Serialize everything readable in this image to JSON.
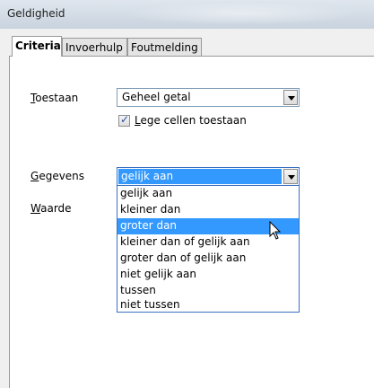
{
  "window": {
    "title": "Geldigheid"
  },
  "tabs": [
    {
      "label": "Criteria",
      "active": true
    },
    {
      "label": "Invoerhulp",
      "active": false
    },
    {
      "label": "Foutmelding",
      "active": false
    }
  ],
  "form": {
    "toestaan_label_u": "T",
    "toestaan_label_rest": "oestaan",
    "toestaan_value": "Geheel getal",
    "blank_label_u": "L",
    "blank_label_rest": "ege cellen toestaan",
    "blank_checked": true,
    "gegevens_label_u": "G",
    "gegevens_label_rest": "egevens",
    "gegevens_value": "gelijk aan",
    "waarde_label_u": "W",
    "waarde_label_rest": "aarde"
  },
  "dropdown": {
    "options": [
      "gelijk aan",
      "kleiner dan",
      "groter dan",
      "kleiner dan of gelijk aan",
      "groter dan of gelijk aan",
      "niet gelijk aan",
      "tussen",
      "niet tussen"
    ],
    "selected": "groter dan"
  },
  "colors": {
    "highlight": "#3399ff",
    "focus_border": "#3a70c0"
  },
  "icons": {
    "combo_arrow": "chevron-down-icon",
    "checkbox_tick": "checkmark-icon",
    "cursor": "mouse-pointer-icon"
  }
}
